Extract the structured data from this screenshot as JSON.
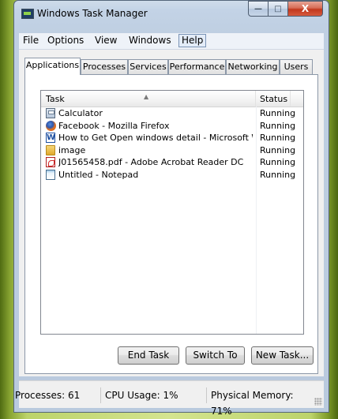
{
  "window": {
    "title": "Windows Task Manager",
    "caption_buttons": {
      "minimize": "—",
      "maximize": "□",
      "close": "X"
    }
  },
  "menu": [
    "File",
    "Options",
    "View",
    "Windows",
    "Help"
  ],
  "tabs": [
    {
      "label": "Applications",
      "selected": true
    },
    {
      "label": "Processes",
      "selected": false
    },
    {
      "label": "Services",
      "selected": false
    },
    {
      "label": "Performance",
      "selected": false
    },
    {
      "label": "Networking",
      "selected": false
    },
    {
      "label": "Users",
      "selected": false
    }
  ],
  "list": {
    "columns": {
      "task": "Task",
      "status": "Status"
    },
    "sort_indicator": "▲",
    "rows": [
      {
        "icon": "calculator-icon",
        "task": "Calculator",
        "status": "Running"
      },
      {
        "icon": "firefox-icon",
        "task": "Facebook - Mozilla Firefox",
        "status": "Running"
      },
      {
        "icon": "word-icon",
        "task": "How to Get Open windows detail - Microsoft Wor...",
        "status": "Running"
      },
      {
        "icon": "folder-icon",
        "task": "image",
        "status": "Running"
      },
      {
        "icon": "pdf-icon",
        "task": "J01565458.pdf - Adobe Acrobat Reader DC",
        "status": "Running"
      },
      {
        "icon": "notepad-icon",
        "task": "Untitled - Notepad",
        "status": "Running"
      }
    ]
  },
  "buttons": {
    "end_task": "End Task",
    "switch_to": "Switch To",
    "new_task": "New Task..."
  },
  "statusbar": {
    "processes": "Processes: 61",
    "cpu": "CPU Usage: 1%",
    "memory": "Physical Memory: 71%"
  },
  "colors": {
    "desktop": "#bcd36a",
    "frame": "#c3d3e6",
    "close_button": "#c2381d"
  }
}
